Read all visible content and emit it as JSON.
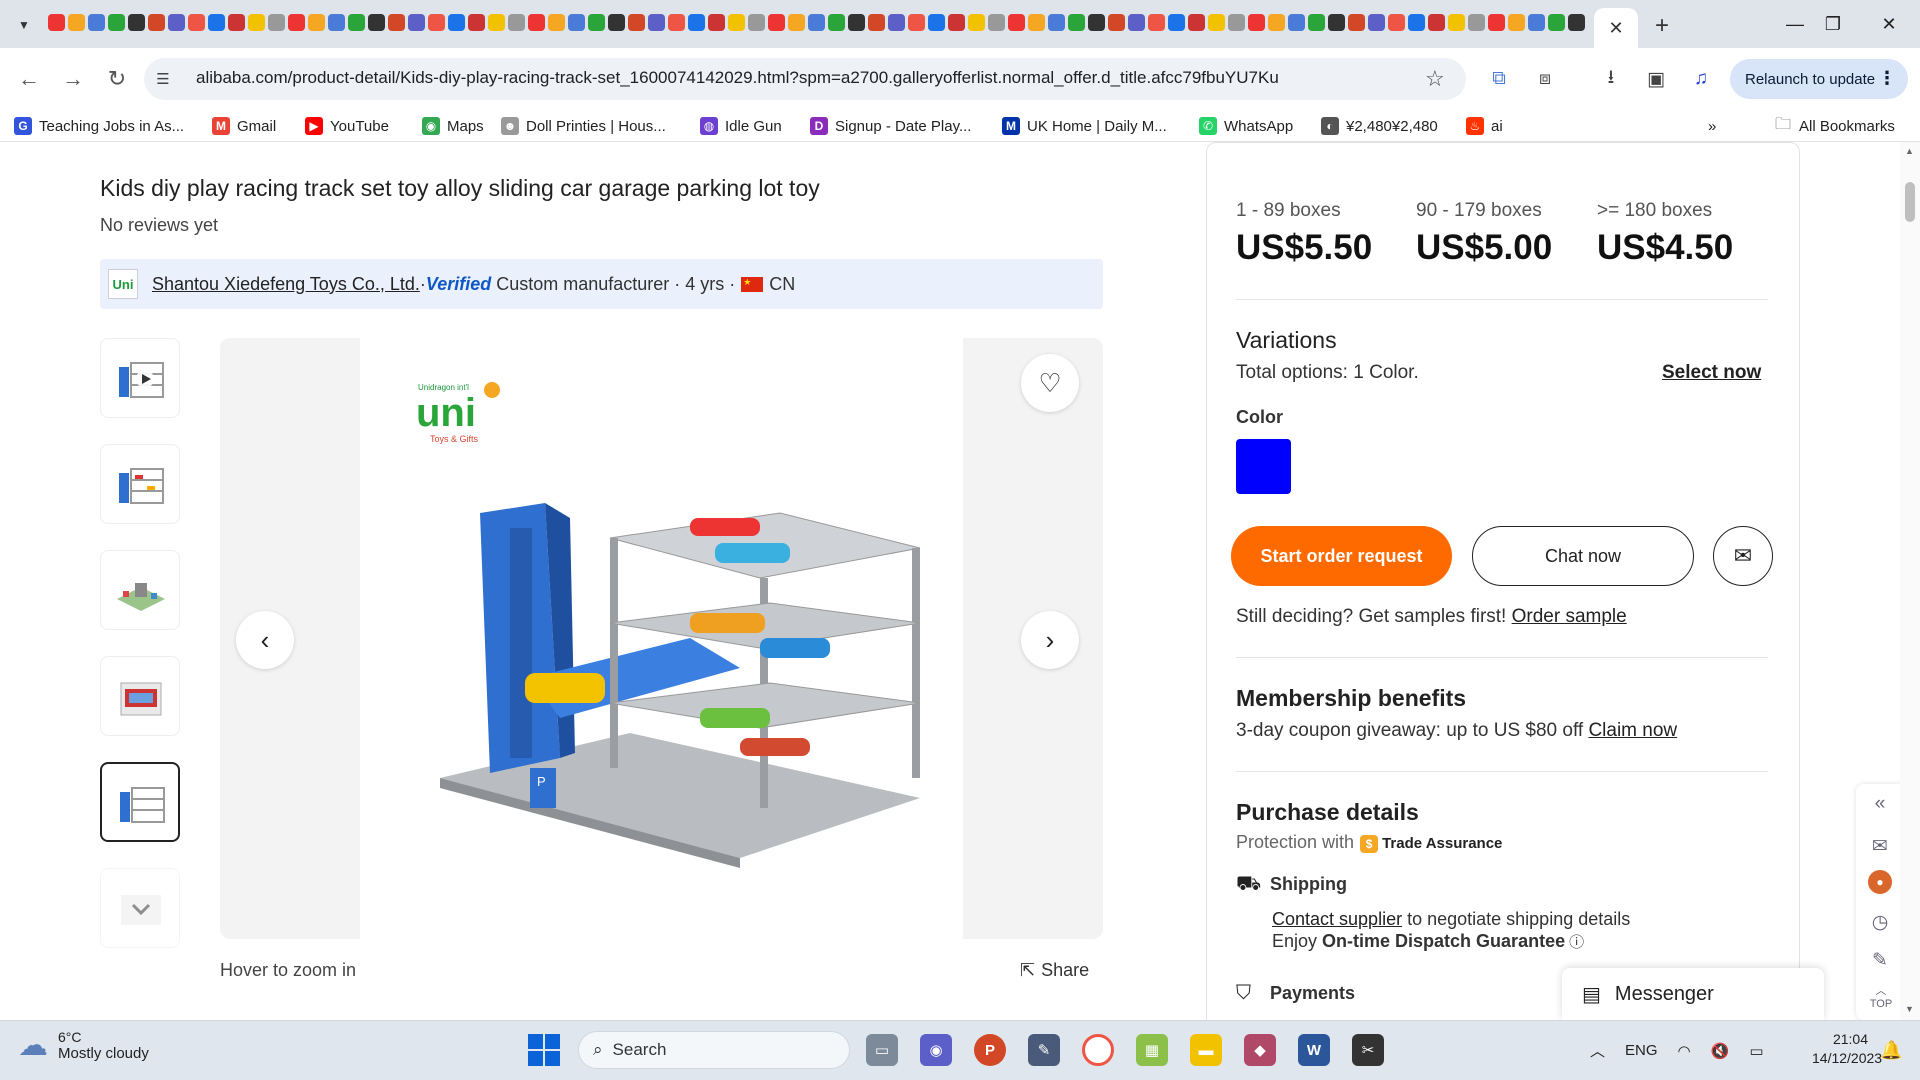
{
  "browser": {
    "url": "alibaba.com/product-detail/Kids-diy-play-racing-track-set_1600074142029.html?spm=a2700.galleryofferlist.normal_offer.d_title.afcc79fbuYU7Ku",
    "relaunch_label": "Relaunch to update",
    "bookmarks": [
      {
        "label": "Teaching Jobs in As...",
        "icon": "go-icon"
      },
      {
        "label": "Gmail",
        "icon": "gmail-icon"
      },
      {
        "label": "YouTube",
        "icon": "youtube-icon"
      },
      {
        "label": "Maps",
        "icon": "maps-icon"
      },
      {
        "label": "Doll Printies | Hous...",
        "icon": "doll-icon"
      },
      {
        "label": "Idle Gun",
        "icon": "idle-gun-icon"
      },
      {
        "label": "Signup - Date Play...",
        "icon": "signup-icon"
      },
      {
        "label": "UK Home | Daily M...",
        "icon": "daily-mail-icon"
      },
      {
        "label": "WhatsApp",
        "icon": "whatsapp-icon"
      },
      {
        "label": "¥2,480¥2,480",
        "icon": "globe-icon"
      },
      {
        "label": "ai",
        "icon": "flame-icon"
      }
    ],
    "all_bookmarks_label": "All Bookmarks"
  },
  "product": {
    "title": "Kids diy play racing track set toy alloy sliding car garage parking lot toy",
    "reviews": "No reviews yet",
    "supplier_name": "Shantou Xiedefeng Toys Co., Ltd.",
    "supplier_sep": " · ",
    "verified": "Verified",
    "supplier_type": "Custom manufacturer · 4 yrs · ",
    "country": "CN",
    "hover_zoom": "Hover to zoom in",
    "share": "Share",
    "brand_logo_text": "uni",
    "brand_logo_sub": "Toys & Gifts",
    "brand_logo_top": "Unidragon int'l"
  },
  "pricing": {
    "tiers": [
      {
        "qty": "1 - 89 boxes",
        "price": "US$5.50"
      },
      {
        "qty": "90 - 179 boxes",
        "price": "US$5.00"
      },
      {
        "qty": ">= 180 boxes",
        "price": "US$4.50"
      }
    ]
  },
  "variations": {
    "title": "Variations",
    "total_prefix": "Total options: ",
    "total_value": "1 Color.",
    "select_now": "Select now",
    "color_label": "Color",
    "swatch_color": "#0000ff"
  },
  "actions": {
    "start_order": "Start order request",
    "chat_now": "Chat now",
    "samples_text": "Still deciding? Get samples first! ",
    "order_sample": "Order sample"
  },
  "membership": {
    "title": "Membership benefits",
    "text": "3-day coupon giveaway: up to US $80 off ",
    "claim": "Claim now"
  },
  "purchase": {
    "title": "Purchase details",
    "protection": "Protection with",
    "trade_assurance": "Trade Assurance",
    "shipping_title": "Shipping",
    "contact_supplier": "Contact supplier",
    "shipping_text": " to negotiate shipping details",
    "enjoy": "Enjoy ",
    "dispatch": "On-time Dispatch Guarantee",
    "payments_title": "Payments"
  },
  "side_tools": {
    "top_label": "TOP"
  },
  "messenger": "Messenger",
  "taskbar": {
    "temp": "6°C",
    "weather": "Mostly cloudy",
    "search": "Search",
    "lang": "ENG",
    "time": "21:04",
    "date": "14/12/2023"
  },
  "colors": {
    "accent_orange": "#ff6a00",
    "supplier_bar": "#eaf1fc",
    "verified_blue": "#0e57c7"
  }
}
